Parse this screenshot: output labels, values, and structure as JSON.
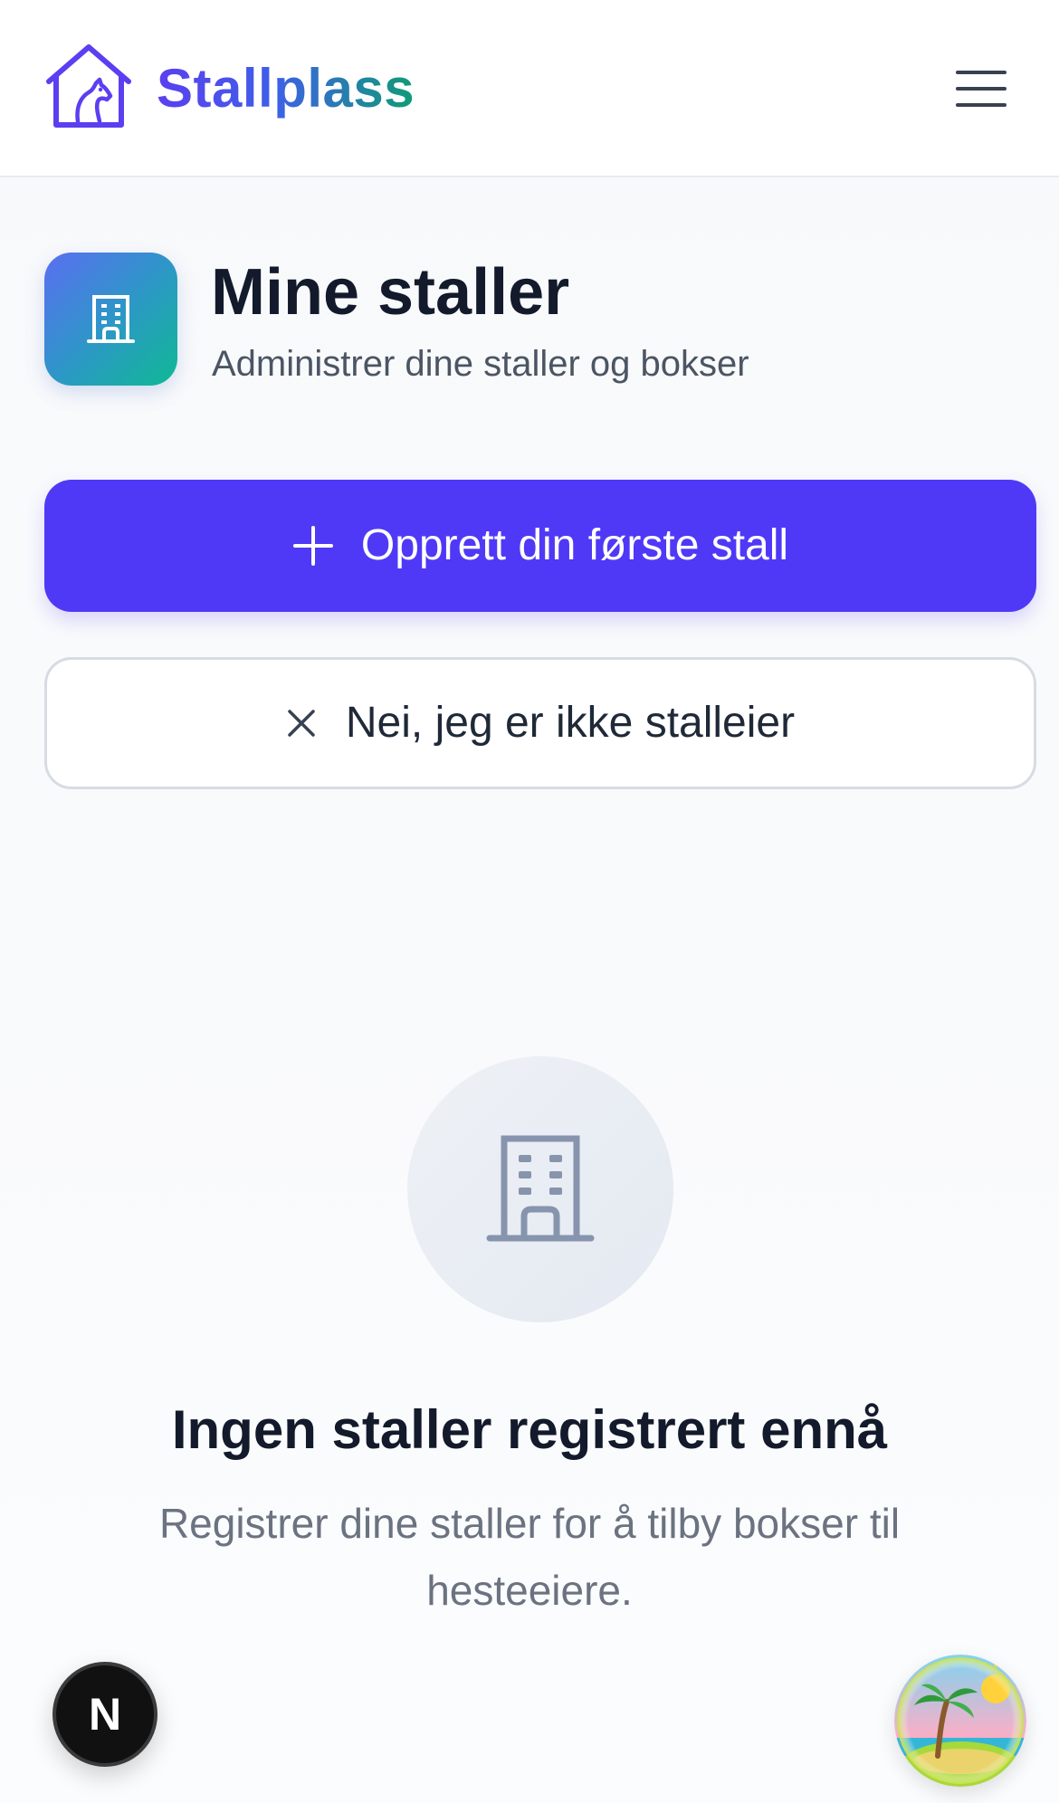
{
  "header": {
    "brand": "Stallplass",
    "logo_icon": "horse-house-icon",
    "menu_icon": "hamburger-menu-icon"
  },
  "page": {
    "title": "Mine staller",
    "subtitle": "Administrer dine staller og bokser",
    "icon": "building-icon"
  },
  "actions": {
    "create_label": "Opprett din første stall",
    "create_icon": "plus-icon",
    "decline_label": "Nei, jeg er ikke stalleier",
    "decline_icon": "close-icon"
  },
  "empty_state": {
    "icon": "building-icon",
    "title": "Ingen staller registrert ennå",
    "text": "Registrer dine staller for å tilby bokser til hesteeiere."
  },
  "dev_badge": {
    "letter": "N"
  },
  "colors": {
    "primary": "#4f39f6",
    "brand_start": "#5b3ff1",
    "brand_end": "#0f9c76",
    "title": "#131a2b",
    "muted": "#6b7280"
  }
}
